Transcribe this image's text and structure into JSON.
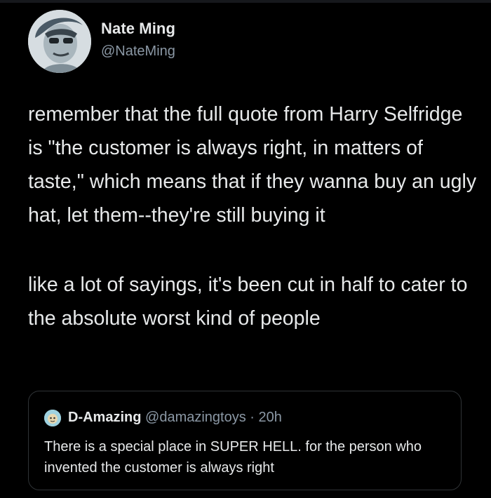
{
  "colors": {
    "background": "#000000",
    "text": "#e7e9ea",
    "secondary_text": "#8b98a5",
    "border": "#2f3336"
  },
  "tweet": {
    "author": {
      "name": "Nate Ming",
      "handle": "@NateMing",
      "avatar_icon": "cartoon-face-avatar"
    },
    "paragraphs": [
      "remember that the full quote from Harry Selfridge is \"the customer is always right, in matters of taste,\" which means that if they wanna buy an ugly hat, let them--they're still buying it",
      "like a lot of sayings, it's been cut in half to cater to the absolute worst kind of people"
    ]
  },
  "quoted_tweet": {
    "name": "D-Amazing",
    "handle": "@damazingtoys",
    "separator": " · ",
    "time": "20h",
    "avatar_icon": "toy-face-avatar",
    "text": "There is a special place in SUPER HELL. for the person who invented the customer is always right"
  }
}
